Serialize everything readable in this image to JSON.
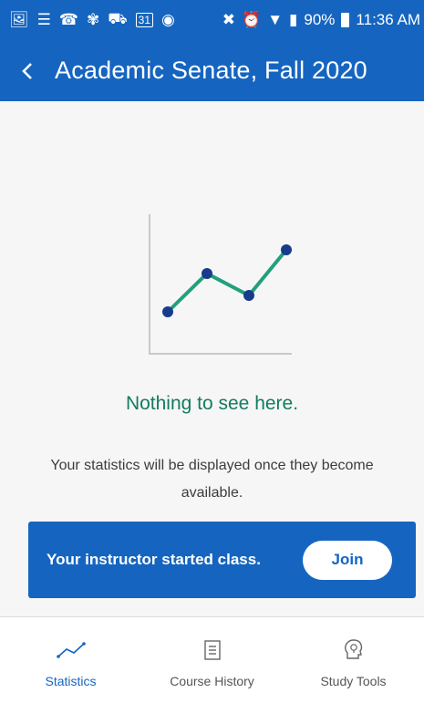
{
  "status_bar": {
    "battery": "90%",
    "time": "11:36 AM",
    "calendar_day": "31"
  },
  "app_bar": {
    "back_icon": "chevron-left-icon",
    "title": "Academic Senate, Fall 2020"
  },
  "empty_state": {
    "title": "Nothing to see here.",
    "description": "Your statistics will be displayed once they become available."
  },
  "banner": {
    "message": "Your instructor started class.",
    "join_label": "Join"
  },
  "bottom_nav": {
    "items": [
      {
        "label": "Statistics",
        "icon": "line-chart-icon",
        "active": true
      },
      {
        "label": "Course History",
        "icon": "list-document-icon",
        "active": false
      },
      {
        "label": "Study Tools",
        "icon": "lightbulb-head-icon",
        "active": false
      }
    ]
  },
  "colors": {
    "primary": "#1565c0",
    "accent_green": "#137b5e",
    "chart_line": "#21a07c",
    "chart_point": "#173c8a"
  }
}
